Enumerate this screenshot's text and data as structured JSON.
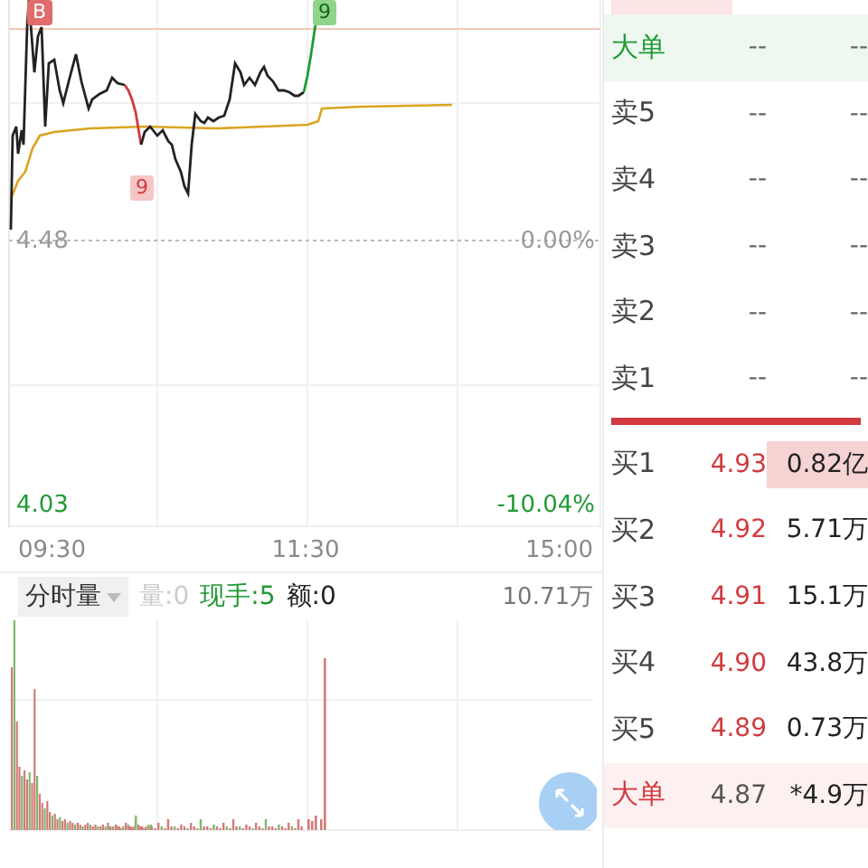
{
  "chart": {
    "base_price": "4.48",
    "base_change": "0.00%",
    "low_price": "4.03",
    "low_change": "-10.04%",
    "times": [
      "09:30",
      "11:30",
      "15:00"
    ],
    "markers": [
      {
        "label": "B",
        "kind": "buy"
      },
      {
        "label": "9",
        "kind": "down"
      },
      {
        "label": "9",
        "kind": "up"
      }
    ]
  },
  "volume": {
    "selector": "分时量",
    "volume_label": "量:0",
    "current_hand": "现手:5",
    "amount": "额:0",
    "max": "10.71万"
  },
  "order_book": {
    "sell_big": {
      "label": "大单",
      "price": "--",
      "volume": "--"
    },
    "asks": [
      {
        "label": "卖5",
        "price": "--",
        "volume": "--"
      },
      {
        "label": "卖4",
        "price": "--",
        "volume": "--"
      },
      {
        "label": "卖3",
        "price": "--",
        "volume": "--"
      },
      {
        "label": "卖2",
        "price": "--",
        "volume": "--"
      },
      {
        "label": "卖1",
        "price": "--",
        "volume": "--"
      }
    ],
    "bids": [
      {
        "label": "买1",
        "price": "4.93",
        "volume": "0.82亿",
        "highlighted": true
      },
      {
        "label": "买2",
        "price": "4.92",
        "volume": "5.71万",
        "highlighted": false
      },
      {
        "label": "买3",
        "price": "4.91",
        "volume": "15.1万",
        "highlighted": false
      },
      {
        "label": "买4",
        "price": "4.90",
        "volume": "43.8万",
        "highlighted": false
      },
      {
        "label": "买5",
        "price": "4.89",
        "volume": "0.73万",
        "highlighted": false
      }
    ],
    "buy_big": {
      "label": "大单",
      "price": "4.87",
      "volume": "*4.9万"
    }
  }
}
